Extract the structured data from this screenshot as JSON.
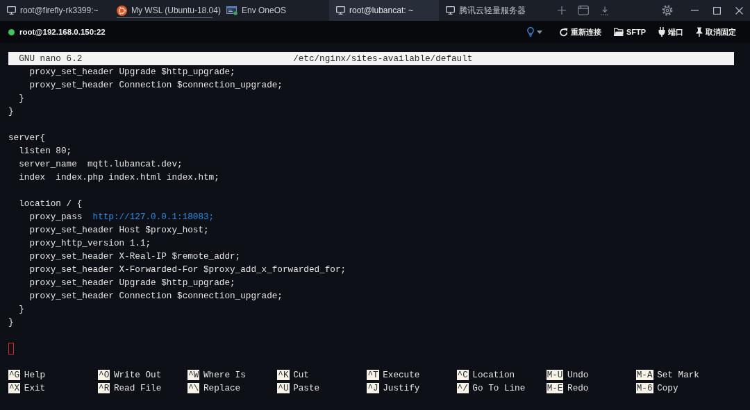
{
  "tabs": [
    {
      "kind": "ssh",
      "label": "root@firefly-rk3399:~",
      "selected": false,
      "hovered": false
    },
    {
      "kind": "wsl",
      "label": "My WSL (Ubuntu-18.04)",
      "selected": false,
      "hovered": true
    },
    {
      "kind": "env",
      "label": "Env OneOS",
      "selected": false,
      "hovered": false
    },
    {
      "kind": "ssh",
      "label": "root@lubancat: ~",
      "selected": true,
      "hovered": false
    },
    {
      "kind": "ssh",
      "label": "腾讯云轻量服务器",
      "selected": false,
      "hovered": false
    }
  ],
  "session": {
    "host": "root@192.168.0.150:22",
    "connected": true,
    "actions": [
      {
        "kind": "reconnect",
        "label": "重新连接"
      },
      {
        "kind": "sftp",
        "label": "SFTP"
      },
      {
        "kind": "port",
        "label": "端口"
      },
      {
        "kind": "pin",
        "label": "取消固定"
      }
    ]
  },
  "editor": {
    "app": "GNU nano 6.2",
    "file": "/etc/nginx/sites-available/default",
    "lines": [
      {
        "kind": "code",
        "text": "    proxy_set_header Upgrade $http_upgrade;"
      },
      {
        "kind": "code",
        "text": "    proxy_set_header Connection $connection_upgrade;"
      },
      {
        "kind": "code",
        "text": "  }"
      },
      {
        "kind": "code",
        "text": "}"
      },
      {
        "kind": "blank"
      },
      {
        "kind": "code",
        "text": "server{"
      },
      {
        "kind": "code",
        "text": "  listen 80;"
      },
      {
        "kind": "code",
        "text": "  server_name  mqtt.lubancat.dev;"
      },
      {
        "kind": "code",
        "text": "  index  index.php index.html index.htm;"
      },
      {
        "kind": "blank"
      },
      {
        "kind": "code",
        "text": "  location / {"
      },
      {
        "kind": "code",
        "text": "    proxy_pass  ",
        "url": "http://127.0.0.1:18083;"
      },
      {
        "kind": "code",
        "text": "    proxy_set_header Host $proxy_host;"
      },
      {
        "kind": "code",
        "text": "    proxy_http_version 1.1;"
      },
      {
        "kind": "code",
        "text": "    proxy_set_header X-Real-IP $remote_addr;"
      },
      {
        "kind": "code",
        "text": "    proxy_set_header X-Forwarded-For $proxy_add_x_forwarded_for;"
      },
      {
        "kind": "code",
        "text": "    proxy_set_header Upgrade $http_upgrade;"
      },
      {
        "kind": "code",
        "text": "    proxy_set_header Connection $connection_upgrade;"
      },
      {
        "kind": "code",
        "text": "  }"
      },
      {
        "kind": "code",
        "text": "}"
      },
      {
        "kind": "blank"
      },
      {
        "kind": "cursor"
      }
    ],
    "shortcut_rows": [
      {
        "items": [
          {
            "key": "^G",
            "label": "Help"
          },
          {
            "key": "^O",
            "label": "Write Out"
          },
          {
            "key": "^W",
            "label": "Where Is"
          },
          {
            "key": "^K",
            "label": "Cut"
          },
          {
            "key": "^T",
            "label": "Execute"
          },
          {
            "key": "^C",
            "label": "Location"
          },
          {
            "key": "M-U",
            "label": "Undo"
          },
          {
            "key": "M-A",
            "label": "Set Mark"
          }
        ]
      },
      {
        "items": [
          {
            "key": "^X",
            "label": "Exit"
          },
          {
            "key": "^R",
            "label": "Read File"
          },
          {
            "key": "^\\",
            "label": "Replace"
          },
          {
            "key": "^U",
            "label": "Paste"
          },
          {
            "key": "^J",
            "label": "Justify"
          },
          {
            "key": "^/",
            "label": "Go To Line"
          },
          {
            "key": "M-E",
            "label": "Redo"
          },
          {
            "key": "M-6",
            "label": "Copy"
          }
        ]
      }
    ]
  }
}
